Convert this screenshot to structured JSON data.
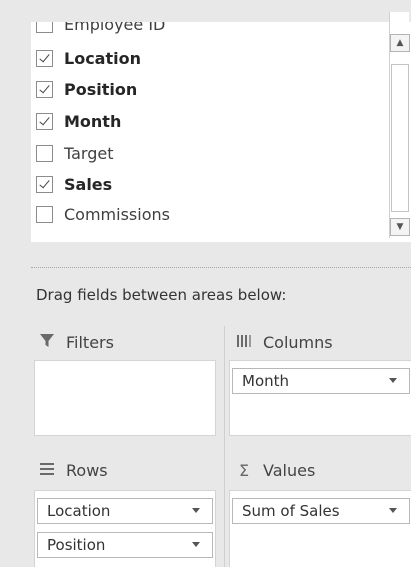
{
  "field_list": {
    "items": [
      {
        "label": "Employee ID",
        "checked": true,
        "bold": false
      },
      {
        "label": "Location",
        "checked": true,
        "bold": true
      },
      {
        "label": "Position",
        "checked": true,
        "bold": true
      },
      {
        "label": "Month",
        "checked": true,
        "bold": true
      },
      {
        "label": "Target",
        "checked": false,
        "bold": false
      },
      {
        "label": "Sales",
        "checked": true,
        "bold": true
      },
      {
        "label": "Commissions",
        "checked": false,
        "bold": false
      }
    ]
  },
  "scrollbar": {
    "up_icon": "scroll-up-arrow",
    "down_icon": "scroll-down-arrow"
  },
  "drag_label": "Drag fields between areas below:",
  "areas": {
    "filters": {
      "title": "Filters",
      "icon": "filter-icon",
      "fields": []
    },
    "columns": {
      "title": "Columns",
      "icon": "columns-icon",
      "fields": [
        "Month"
      ]
    },
    "rows": {
      "title": "Rows",
      "icon": "rows-icon",
      "fields": [
        "Location",
        "Position"
      ]
    },
    "values": {
      "title": "Values",
      "icon": "sigma-icon",
      "fields": [
        "Sum of Sales"
      ]
    }
  }
}
